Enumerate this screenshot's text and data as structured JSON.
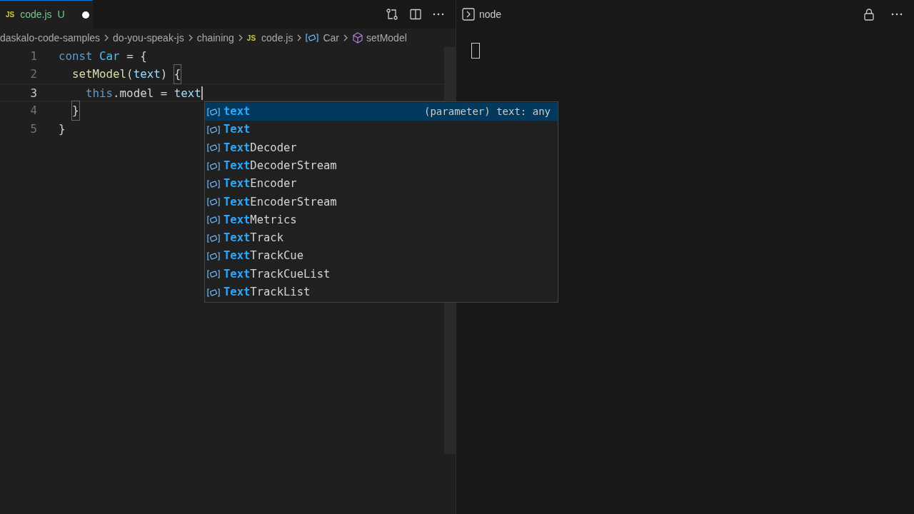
{
  "editor_tab": {
    "badge": "JS",
    "filename": "code.js",
    "status": "U",
    "dirty": true
  },
  "breadcrumbs": [
    {
      "text": "daskalo-code-samples",
      "kind": "folder"
    },
    {
      "text": "do-you-speak-js",
      "kind": "folder"
    },
    {
      "text": "chaining",
      "kind": "folder"
    },
    {
      "text": "code.js",
      "kind": "file"
    },
    {
      "text": "Car",
      "kind": "variable"
    },
    {
      "text": "setModel",
      "kind": "method"
    }
  ],
  "js_badge": "JS",
  "code_lines": [
    {
      "number": "1",
      "current": false,
      "tokens": [
        {
          "text": "const ",
          "kind": "keyword"
        },
        {
          "text": "Car",
          "kind": "constant"
        },
        {
          "text": " = {",
          "kind": "plain"
        }
      ]
    },
    {
      "number": "2",
      "current": false,
      "tokens": [
        {
          "text": "  setModel",
          "kind": "function"
        },
        {
          "text": "(",
          "kind": "plain"
        },
        {
          "text": "text",
          "kind": "param"
        },
        {
          "text": ") ",
          "kind": "plain"
        },
        {
          "text": "{",
          "kind": "bracket"
        }
      ]
    },
    {
      "number": "3",
      "current": true,
      "tokens": [
        {
          "text": "    this",
          "kind": "keyword"
        },
        {
          "text": ".model = ",
          "kind": "plain"
        },
        {
          "text": "text",
          "kind": "param"
        }
      ]
    },
    {
      "number": "4",
      "current": false,
      "tokens": [
        {
          "text": "  }",
          "kind": "bracket"
        }
      ]
    },
    {
      "number": "5",
      "current": false,
      "tokens": [
        {
          "text": "}",
          "kind": "plain"
        }
      ]
    }
  ],
  "suggestions": [
    {
      "match": "text",
      "selected": true,
      "detail": "(parameter) text: any"
    },
    {
      "match": "Text",
      "selected": false
    },
    {
      "match": "Text",
      "rest": "Decoder",
      "selected": false
    },
    {
      "match": "Text",
      "rest": "DecoderStream",
      "selected": false
    },
    {
      "match": "Text",
      "rest": "Encoder",
      "selected": false
    },
    {
      "match": "Text",
      "rest": "EncoderStream",
      "selected": false
    },
    {
      "match": "Text",
      "rest": "Metrics",
      "selected": false
    },
    {
      "match": "Text",
      "rest": "Track",
      "selected": false
    },
    {
      "match": "Text",
      "rest": "TrackCue",
      "selected": false
    },
    {
      "match": "Text",
      "rest": "TrackCueList",
      "selected": false
    },
    {
      "match": "Text",
      "rest": "TrackList",
      "selected": false
    }
  ],
  "terminal": {
    "title": "node"
  }
}
